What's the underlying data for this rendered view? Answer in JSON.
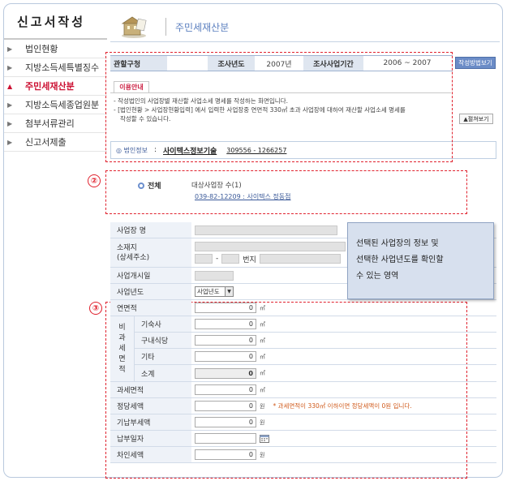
{
  "sidebar": {
    "title": "신고서작성",
    "items": [
      {
        "label": "법인현황"
      },
      {
        "label": "지방소득세특별징수"
      },
      {
        "label": "주민세재산분"
      },
      {
        "label": "지방소득세종업원분"
      },
      {
        "label": "첨부서류관리"
      },
      {
        "label": "신고서제출"
      }
    ],
    "active_index": 2
  },
  "header": {
    "title": "주민세재산분"
  },
  "info": {
    "jurisdiction_label": "관할구청",
    "jurisdiction_value": "",
    "year_label": "조사년도",
    "year_value": "2007년",
    "period_label": "조사사업기간",
    "period_value": "2006 ~ 2007",
    "guide_button": "작성방법보기"
  },
  "guide": {
    "tab_label": "이용안내",
    "line1": "- 작성법인의 사업장별 재산할 사업소세 명세를 작성하는 화면입니다.",
    "line2": "- [법인현황 > 사업장현황입력] 에서 입력한 사업장중 연면적 330㎡ 초과 사업장에 대하여 재산할 사업소세 명세를",
    "line3": "  작성할 수 있습니다.",
    "fold_button": "▲펼쳐보기"
  },
  "corp": {
    "label": "◎ 법인정보",
    "colon": ":",
    "name": "사이텍스정보기술",
    "number": "309556 - 1266257"
  },
  "annotations": {
    "box2_num": "②",
    "box3_num": "③"
  },
  "business": {
    "all_label": "전체",
    "count_label": "대상사업장 수(1)",
    "link": "039-82-12209 : 사이텍스 정동점"
  },
  "form": {
    "biz_name": "사업장 명",
    "address_line1": "소재지",
    "address_line2": "(상세주소)",
    "address_dash": "-",
    "address_bunji": "번지",
    "start_date": "사업개시일",
    "biz_year": "사업년도",
    "biz_year_select": "사업년도",
    "floor_area": "연면적",
    "nontax_chars": [
      "비",
      "과",
      "세",
      "면",
      "적"
    ],
    "dorm": "기숙사",
    "cafeteria": "구내식당",
    "other": "기타",
    "subtotal": "소계",
    "taxable_area": "과세면적",
    "tax_amount": "정당세액",
    "paid_tax": "기납부세액",
    "pay_date": "납부일자",
    "diff_tax": "차인세액",
    "zero": "0",
    "unit_m2": "㎡",
    "unit_won": "원",
    "tax_note": "* 과세면적이 330㎡ 이하이면 정당세액이 0원 입니다."
  },
  "tooltip": {
    "line1": "선택된 사업장의 정보 및",
    "line2": "선택한 사업년도를 확인할",
    "line3": "수 있는 영역"
  }
}
